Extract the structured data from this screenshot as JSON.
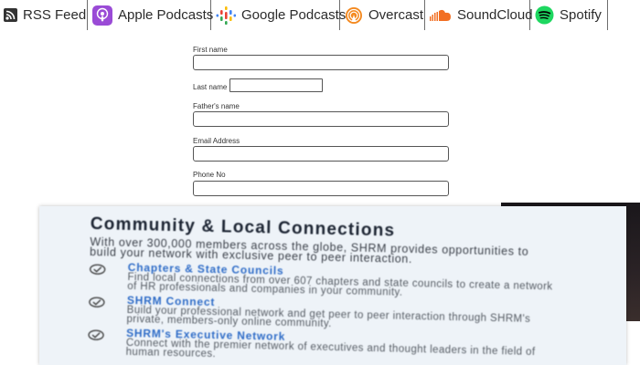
{
  "podcast_bar": {
    "items": [
      {
        "label": "RSS Feed",
        "icon": "rss-icon"
      },
      {
        "label": "Apple Podcasts",
        "icon": "apple-podcasts-icon"
      },
      {
        "label": "Google Podcasts",
        "icon": "google-podcasts-icon"
      },
      {
        "label": "Overcast",
        "icon": "overcast-icon"
      },
      {
        "label": "SoundCloud",
        "icon": "soundcloud-icon"
      },
      {
        "label": "Spotify",
        "icon": "spotify-icon"
      }
    ]
  },
  "form": {
    "first_name_label": "First name",
    "last_name_label": "Last name",
    "fathers_name_label": "Father's name",
    "email_label": "Email Address",
    "phone_label": "Phone No",
    "first_name_value": "",
    "last_name_value": "",
    "fathers_name_value": "",
    "email_value": "",
    "phone_value": ""
  },
  "card": {
    "title": "Community & Local Connections",
    "intro": "With over 300,000 members across the globe, SHRM provides opportunities to build your network with exclusive peer to peer interaction.",
    "items": [
      {
        "heading": "Chapters & State Councils",
        "description": "Find local connections from over 607 chapters and state councils to create a network of HR professionals and companies in your community."
      },
      {
        "heading": "SHRM Connect",
        "description": "Build your professional network and get peer to peer interaction through SHRM's private, members-only online community."
      },
      {
        "heading": "SHRM's Executive Network",
        "description": "Connect with the premier network of executives and thought leaders in the field of human resources."
      }
    ]
  },
  "colors": {
    "apple_podcasts": "#9a4bd6",
    "google_red": "#ea4335",
    "google_yellow": "#fbbc04",
    "google_green": "#34a853",
    "google_blue": "#4285f4",
    "overcast": "#f4891f",
    "soundcloud": "#f26f23",
    "spotify": "#1ed760",
    "card_link": "#2d6bc7"
  }
}
